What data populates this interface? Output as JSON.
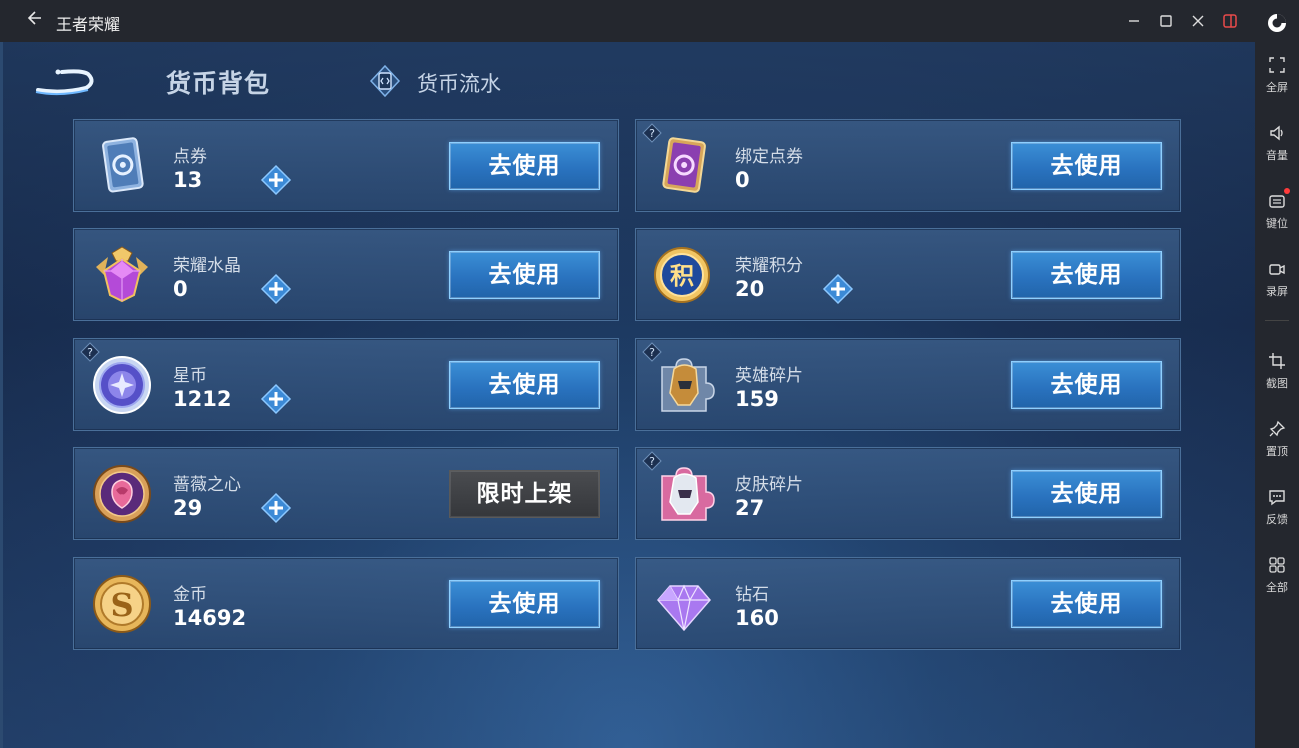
{
  "window": {
    "title": "王者荣耀"
  },
  "tabs": {
    "wallet": "货币背包",
    "flow": "货币流水"
  },
  "sidebar": {
    "items": [
      {
        "label": "全屏",
        "icon": "fullscreen-icon"
      },
      {
        "label": "音量",
        "icon": "volume-icon"
      },
      {
        "label": "键位",
        "icon": "keyboard-icon"
      },
      {
        "label": "录屏",
        "icon": "record-icon"
      },
      {
        "label": "截图",
        "icon": "crop-icon"
      },
      {
        "label": "置顶",
        "icon": "pin-icon"
      },
      {
        "label": "反馈",
        "icon": "feedback-icon"
      },
      {
        "label": "全部",
        "icon": "apps-icon"
      }
    ]
  },
  "currencies": [
    {
      "name": "点券",
      "value": "13",
      "button": "去使用",
      "icon": "voucher-icon"
    },
    {
      "name": "绑定点券",
      "value": "0",
      "button": "去使用",
      "icon": "bound-voucher-icon"
    },
    {
      "name": "荣耀水晶",
      "value": "0",
      "button": "去使用",
      "icon": "glory-crystal-icon"
    },
    {
      "name": "荣耀积分",
      "value": "20",
      "button": "去使用",
      "icon": "glory-points-icon"
    },
    {
      "name": "星币",
      "value": "1212",
      "button": "去使用",
      "icon": "star-coin-icon"
    },
    {
      "name": "英雄碎片",
      "value": "159",
      "button": "去使用",
      "icon": "hero-fragment-icon"
    },
    {
      "name": "蔷薇之心",
      "value": "29",
      "button": "限时上架",
      "icon": "rose-heart-icon"
    },
    {
      "name": "皮肤碎片",
      "value": "27",
      "button": "去使用",
      "icon": "skin-fragment-icon"
    },
    {
      "name": "金币",
      "value": "14692",
      "button": "去使用",
      "icon": "gold-coin-icon"
    },
    {
      "name": "钻石",
      "value": "160",
      "button": "去使用",
      "icon": "diamond-icon"
    }
  ],
  "colors": {
    "button_blue": "#2a73bf",
    "button_gray": "#3a3c40",
    "background": "#1e3d66"
  }
}
